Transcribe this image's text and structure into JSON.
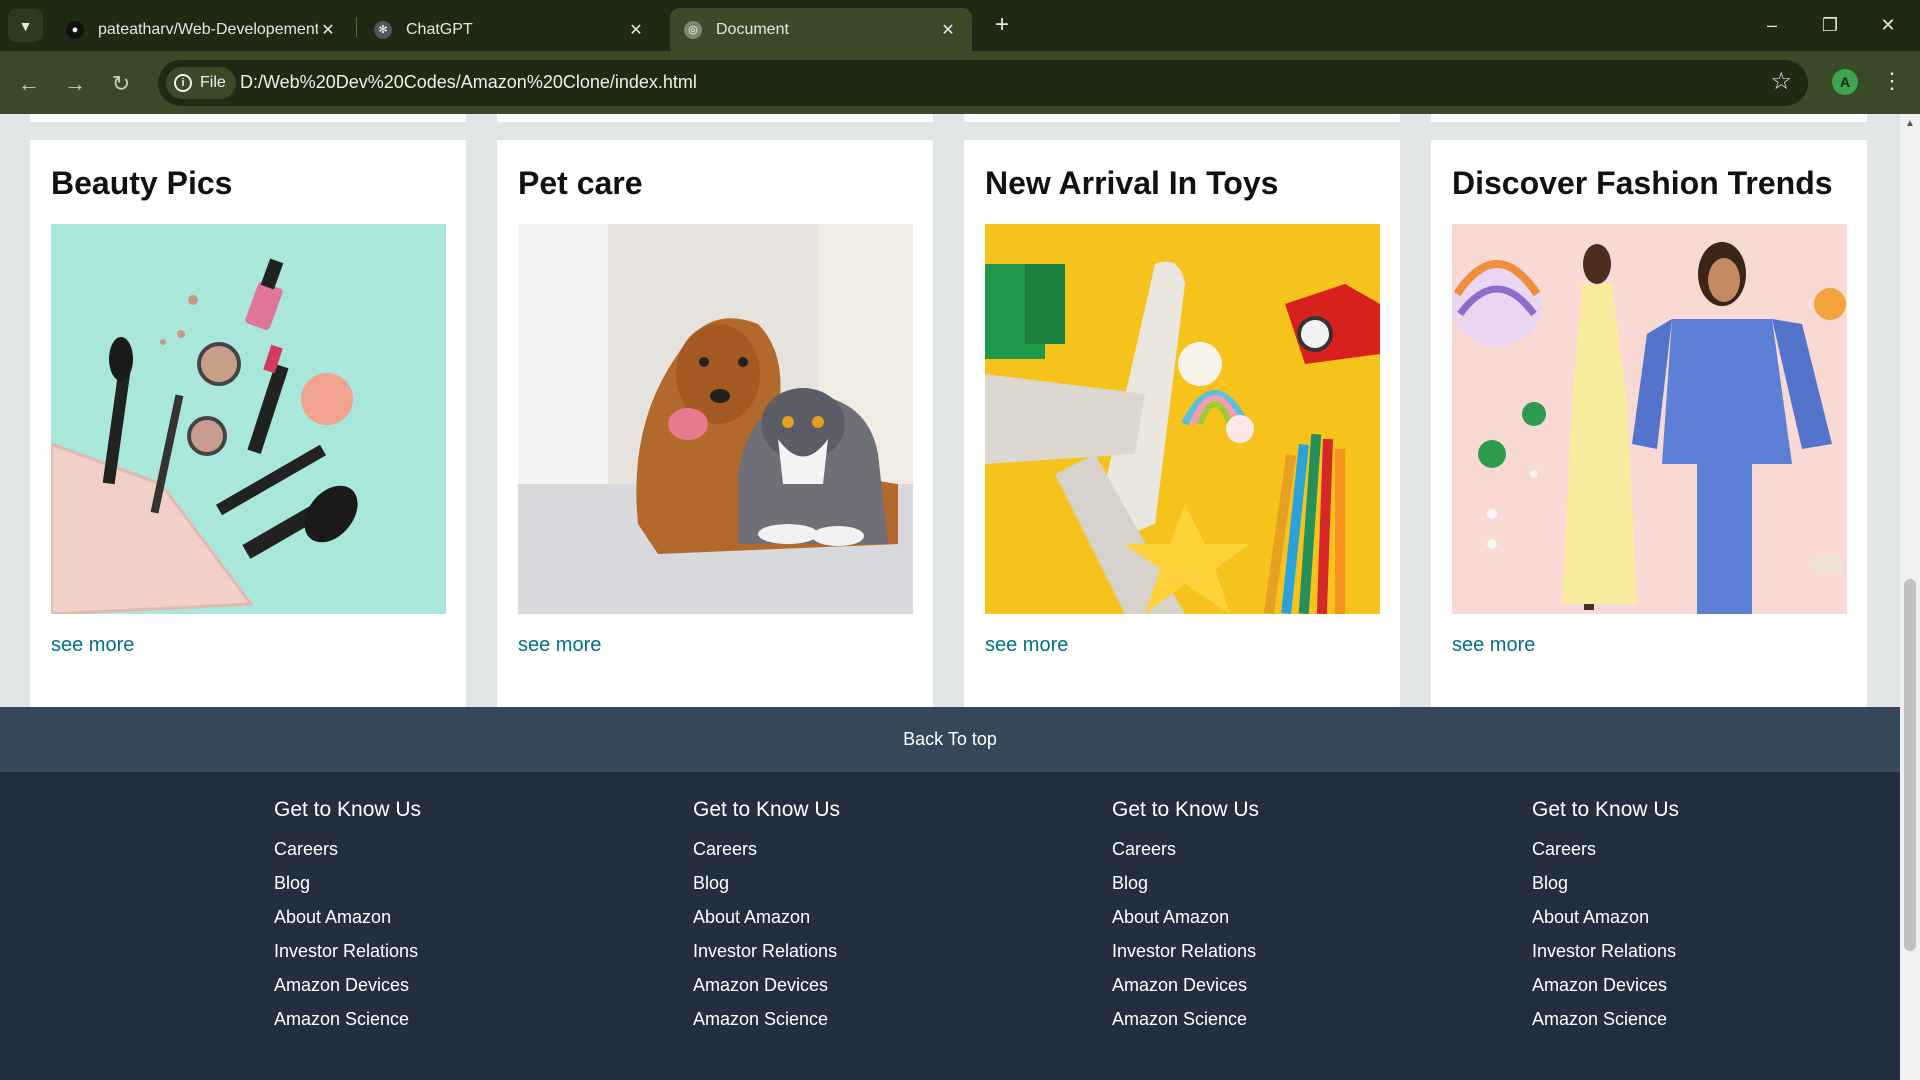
{
  "browser": {
    "tabs": [
      {
        "title": "pateatharv/Web-Developement",
        "icon": "github-icon"
      },
      {
        "title": "ChatGPT",
        "icon": "openai-icon"
      },
      {
        "title": "Document",
        "icon": "globe-icon",
        "active": true
      }
    ],
    "site_chip": "File",
    "url": "D:/Web%20Dev%20Codes/Amazon%20Clone/index.html",
    "profile_initial": "A"
  },
  "cards": [
    {
      "title": "Beauty Pics",
      "image": "makeup-flatlay",
      "link": "see more"
    },
    {
      "title": "Pet care",
      "image": "dog-and-cat",
      "link": "see more"
    },
    {
      "title": "New Arrival In Toys",
      "image": "toys-flatlay",
      "link": "see more"
    },
    {
      "title": "Discover Fashion Trends",
      "image": "fashion-models",
      "link": "see more"
    }
  ],
  "back_to_top": "Back To top",
  "footer": {
    "columns": [
      {
        "heading": "Get to Know Us",
        "links": [
          "Careers",
          "Blog",
          "About Amazon",
          "Investor Relations",
          "Amazon Devices",
          "Amazon Science"
        ]
      },
      {
        "heading": "Get to Know Us",
        "links": [
          "Careers",
          "Blog",
          "About Amazon",
          "Investor Relations",
          "Amazon Devices",
          "Amazon Science"
        ]
      },
      {
        "heading": "Get to Know Us",
        "links": [
          "Careers",
          "Blog",
          "About Amazon",
          "Investor Relations",
          "Amazon Devices",
          "Amazon Science"
        ]
      },
      {
        "heading": "Get to Know Us",
        "links": [
          "Careers",
          "Blog",
          "About Amazon",
          "Investor Relations",
          "Amazon Devices",
          "Amazon Science"
        ]
      }
    ]
  },
  "colors": {
    "link": "#007185",
    "back_to_top_bg": "#37475a",
    "footer_bg": "#232f3e",
    "page_bg": "#e3e6e6",
    "chrome_bg": "#1f2a14"
  }
}
